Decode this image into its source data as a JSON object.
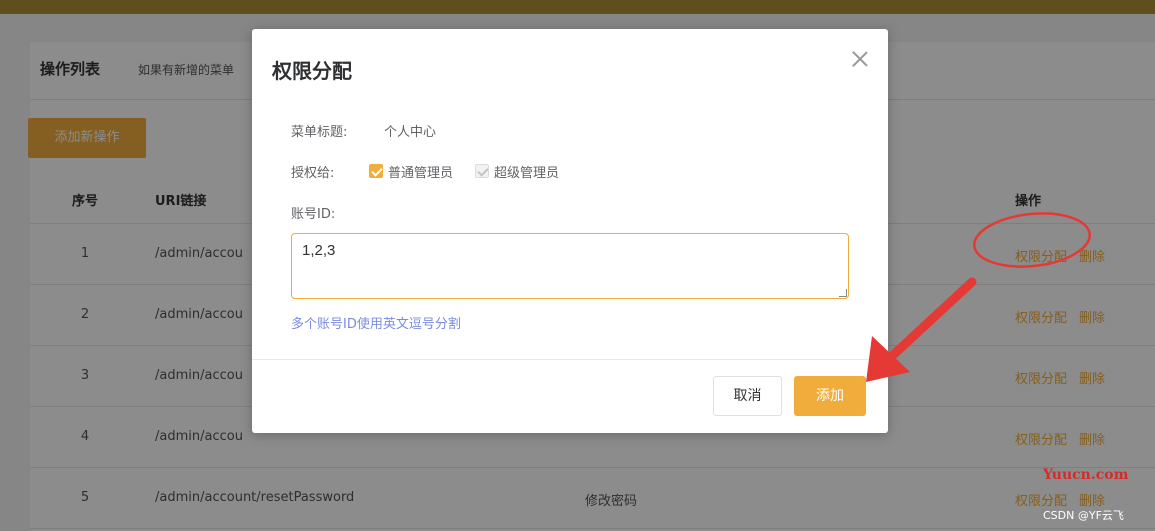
{
  "page": {
    "title": "操作列表",
    "description": "如果有新增的菜单",
    "add_button": "添加新操作"
  },
  "table": {
    "headers": {
      "no": "序号",
      "uri": "URI链接",
      "op": "操作"
    },
    "rows": [
      {
        "no": "1",
        "uri": "/admin/accou",
        "name": ""
      },
      {
        "no": "2",
        "uri": "/admin/accou",
        "name": ""
      },
      {
        "no": "3",
        "uri": "/admin/accou",
        "name": ""
      },
      {
        "no": "4",
        "uri": "/admin/accou",
        "name": ""
      },
      {
        "no": "5",
        "uri": "/admin/account/resetPassword",
        "name": "修改密码"
      }
    ],
    "op_assign": "权限分配",
    "op_delete": "删除"
  },
  "modal": {
    "title": "权限分配",
    "menu_title_label": "菜单标题:",
    "menu_title_value": "个人中心",
    "grant_label": "授权给:",
    "checkbox_normal_admin": "普通管理员",
    "checkbox_super_admin": "超级管理员",
    "account_id_label": "账号ID:",
    "account_id_value": "1,2,3",
    "hint": "多个账号ID使用英文逗号分割",
    "cancel_label": "取消",
    "add_label": "添加"
  },
  "watermark": "Yuucn.com",
  "credit": "CSDN @YF云飞",
  "colors": {
    "accent": "#f0ad3c",
    "annotation": "#e53935"
  }
}
